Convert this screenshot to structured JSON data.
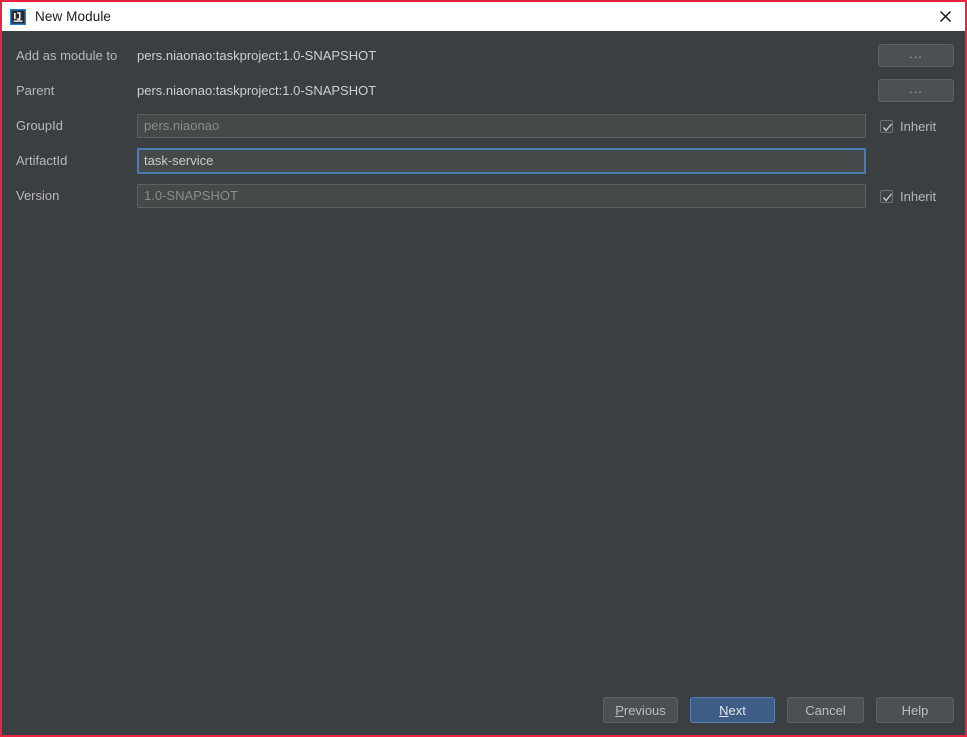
{
  "window": {
    "title": "New Module",
    "icon": "intellij-idea-icon",
    "close_icon": "close-icon",
    "border_color": "#e8243e",
    "titlebar_bg": "#ffffff",
    "body_bg": "#3c3f41"
  },
  "form": {
    "rows": [
      {
        "label": "Add as module to",
        "type": "static",
        "value": "pers.niaonao:taskproject:1.0-SNAPSHOT",
        "browse_label": "...",
        "has_browse": true,
        "has_inherit": false
      },
      {
        "label": "Parent",
        "type": "static",
        "value": "pers.niaonao:taskproject:1.0-SNAPSHOT",
        "browse_label": "...",
        "has_browse": true,
        "has_inherit": false
      },
      {
        "label": "GroupId",
        "type": "field",
        "value": "pers.niaonao",
        "focused": false,
        "has_browse": false,
        "has_inherit": true,
        "inherit_label": "Inherit",
        "inherit_checked": true
      },
      {
        "label": "ArtifactId",
        "type": "field",
        "value": "task-service",
        "focused": true,
        "has_browse": false,
        "has_inherit": false
      },
      {
        "label": "Version",
        "type": "field",
        "value": "1.0-SNAPSHOT",
        "focused": false,
        "has_browse": false,
        "has_inherit": true,
        "inherit_label": "Inherit",
        "inherit_checked": true
      }
    ]
  },
  "footer": {
    "buttons": [
      {
        "label": "Previous",
        "mnemonic": "P",
        "default": false
      },
      {
        "label": "Next",
        "mnemonic": "N",
        "default": true
      },
      {
        "label": "Cancel",
        "mnemonic": "",
        "default": false
      },
      {
        "label": "Help",
        "mnemonic": "",
        "default": false
      }
    ],
    "accent_color": "#3d5c86"
  }
}
